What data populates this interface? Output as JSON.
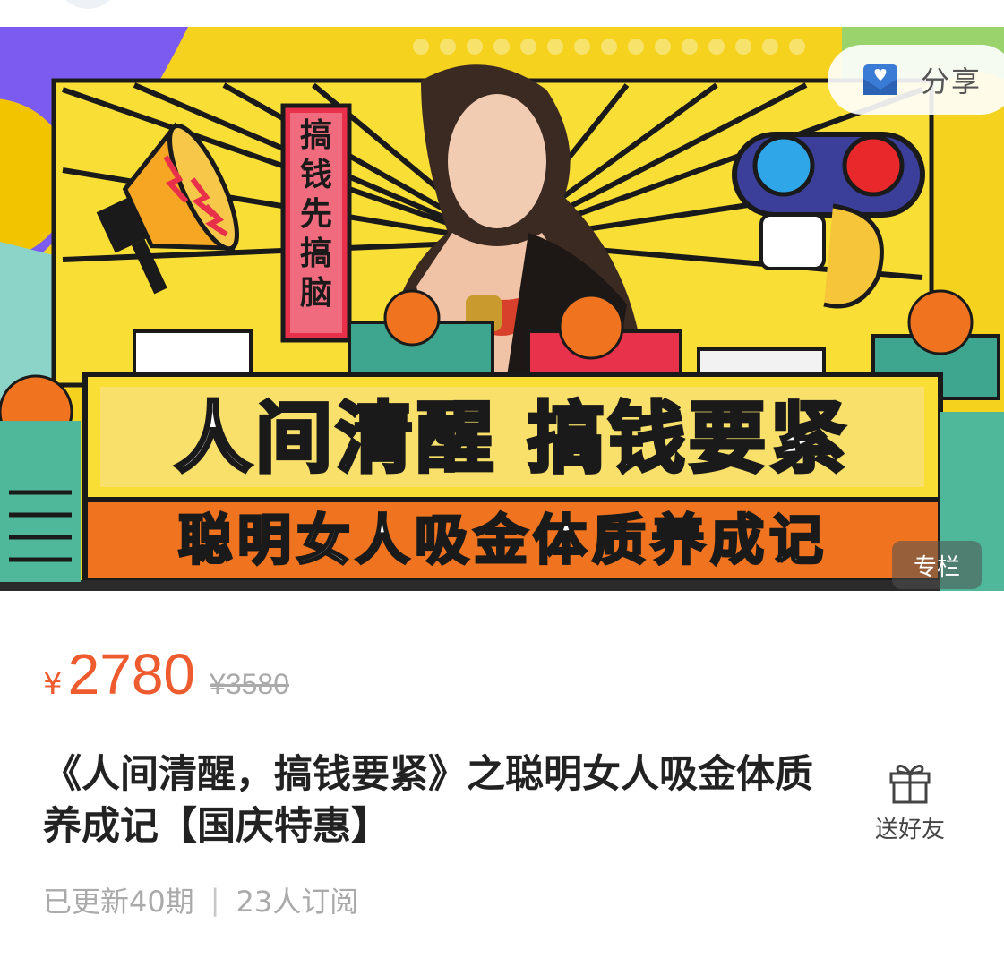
{
  "share": {
    "label": "分享",
    "icon": "heart-envelope-icon"
  },
  "banner": {
    "headline": "人间清醒 搞钱要紧",
    "subheadline": "聪明女人吸金体质养成记",
    "side_tag": "搞钱先搞脑",
    "column_badge": "专栏"
  },
  "pricing": {
    "currency": "¥",
    "price": "2780",
    "original_price": "¥3580"
  },
  "product": {
    "title": "《人间清醒，搞钱要紧》之聪明女人吸金体质养成记【国庆特惠】"
  },
  "gift": {
    "label": "送好友",
    "icon": "gift-icon"
  },
  "meta": {
    "updates": "已更新40期",
    "separator": "|",
    "subscribers": "23人订阅"
  },
  "colors": {
    "accent": "#ee5b2e",
    "banner_yellow": "#f5d21e"
  }
}
